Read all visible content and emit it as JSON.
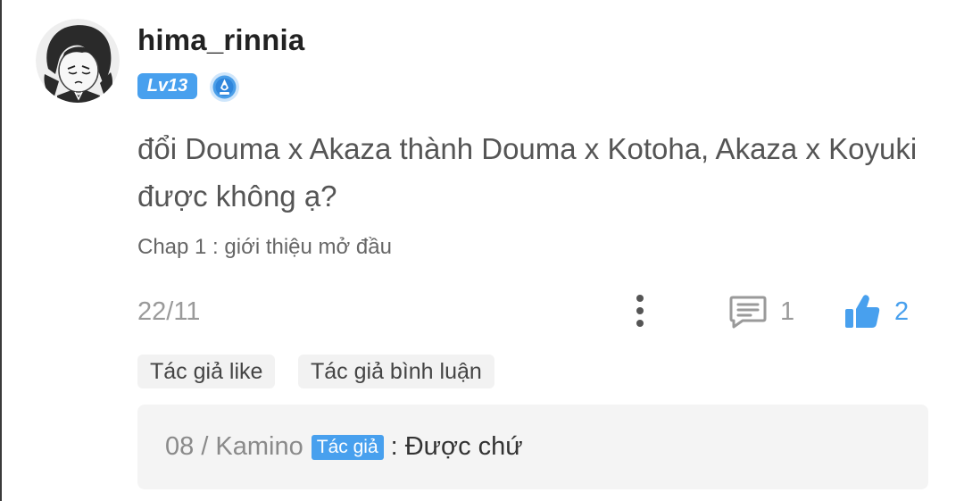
{
  "user": {
    "username": "hima_rinnia",
    "level": "Lv13",
    "avatar_icon": "sketch-portrait-avatar",
    "rank_icon": "blue-rank-medal-icon"
  },
  "comment": {
    "text": "đổi Douma x Akaza thành Douma x Kotoha, Akaza x Koyuki được không ạ?",
    "chapter": "Chap 1 : giới thiệu mở đầu",
    "date": "22/11",
    "reply_count": "1",
    "like_count": "2"
  },
  "tags": {
    "author_liked": "Tác giả like",
    "author_replied": "Tác giả bình luận"
  },
  "reply": {
    "author": "08 / Kamino",
    "author_tag": "Tác giả",
    "separator": ":",
    "text": "Được chứ"
  },
  "colors": {
    "accent": "#48a0ee",
    "muted_text": "#9a9a9a",
    "tag_background": "#f2f2f2",
    "reply_background": "#f4f4f4"
  }
}
